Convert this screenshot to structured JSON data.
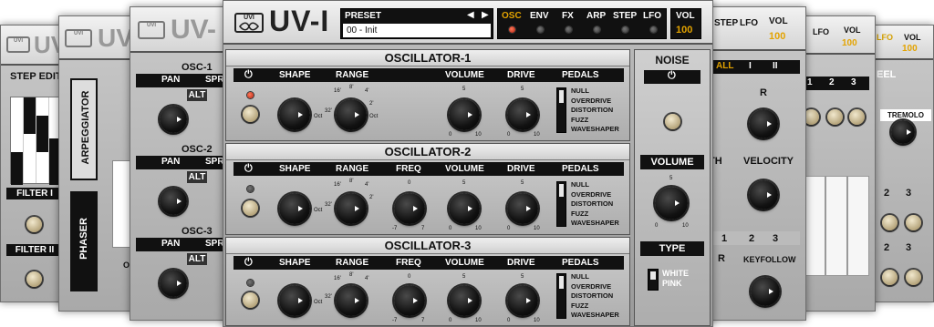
{
  "window": {
    "logo_text": "UVI",
    "title": "UV-I"
  },
  "header": {
    "preset_label": "PRESET",
    "preset_prev": "◀",
    "preset_next": "▶",
    "preset_value": "00 - Init",
    "tabs": [
      "OSC",
      "ENV",
      "FX",
      "ARP",
      "STEP",
      "LFO"
    ],
    "active_tab": "OSC",
    "vol_label": "VOL",
    "vol_value": "100"
  },
  "oscillators": [
    {
      "title": "OSCILLATOR-1",
      "labels": {
        "shape": "SHAPE",
        "range": "RANGE",
        "volume": "VOLUME",
        "drive": "DRIVE",
        "pedals": "PEDALS"
      },
      "pedal_options": [
        "NULL",
        "OVERDRIVE",
        "DISTORTION",
        "FUZZ",
        "WAVESHAPER"
      ]
    },
    {
      "title": "OSCILLATOR-2",
      "labels": {
        "shape": "SHAPE",
        "range": "RANGE",
        "freq": "FREQ",
        "volume": "VOLUME",
        "drive": "DRIVE",
        "pedals": "PEDALS"
      },
      "pedal_options": [
        "NULL",
        "OVERDRIVE",
        "DISTORTION",
        "FUZZ",
        "WAVESHAPER"
      ]
    },
    {
      "title": "OSCILLATOR-3",
      "labels": {
        "shape": "SHAPE",
        "range": "RANGE",
        "freq": "FREQ",
        "volume": "VOLUME",
        "drive": "DRIVE",
        "pedals": "PEDALS"
      },
      "pedal_options": [
        "NULL",
        "OVERDRIVE",
        "DISTORTION",
        "FUZZ",
        "WAVESHAPER"
      ]
    }
  ],
  "knob_scale": {
    "min": "0",
    "mid": "5",
    "max": "10",
    "freq_min": "-7",
    "freq_max": "7",
    "range_32": "32'",
    "range_16": "16'",
    "range_8": "8'",
    "range_4": "4'",
    "range_2": "2'",
    "range_oct": "Oct"
  },
  "noise": {
    "title": "NOISE",
    "volume_label": "VOLUME",
    "type_label": "TYPE",
    "type_options": [
      "WHITE",
      "PINK"
    ]
  },
  "back_panels": {
    "p1": {
      "logo": "UVI",
      "title": "UV-",
      "section": "STEP EDIT",
      "filter1": "FILTER I",
      "filter2": "FILTER II"
    },
    "p2": {
      "logo": "UVI",
      "title": "UV",
      "arp": "ARPEGGIATOR",
      "phaser": "PHASER",
      "o_label": "O"
    },
    "p3": {
      "logo": "UVI",
      "title": "UV-",
      "osc1": "OSC-1",
      "osc2": "OSC-2",
      "osc3": "OSC-3",
      "pan": "PAN",
      "spread": "SPR",
      "alt": "ALT"
    },
    "r1": {
      "tabs": [
        "STEP",
        "LFO"
      ],
      "vol": "VOL",
      "vol_value": "100",
      "all": "ALL",
      "i": "I",
      "ii": "II",
      "r": "R",
      "th": "TH",
      "velocity": "VELOCITY",
      "n1": "1",
      "n2": "2",
      "n3": "3",
      "keyfollow": "KEYFOLLOW"
    },
    "r2": {
      "tabs": [
        "P",
        "LFO"
      ],
      "vol": "VOL",
      "vol_value": "100",
      "n1": "1",
      "n2": "2",
      "n3": "3"
    },
    "r3": {
      "tabs": [
        "LFO"
      ],
      "vol": "VOL",
      "vol_value": "100",
      "section": "EEL",
      "tremolo": "TREMOLO",
      "n2": "2",
      "n3": "3"
    }
  }
}
